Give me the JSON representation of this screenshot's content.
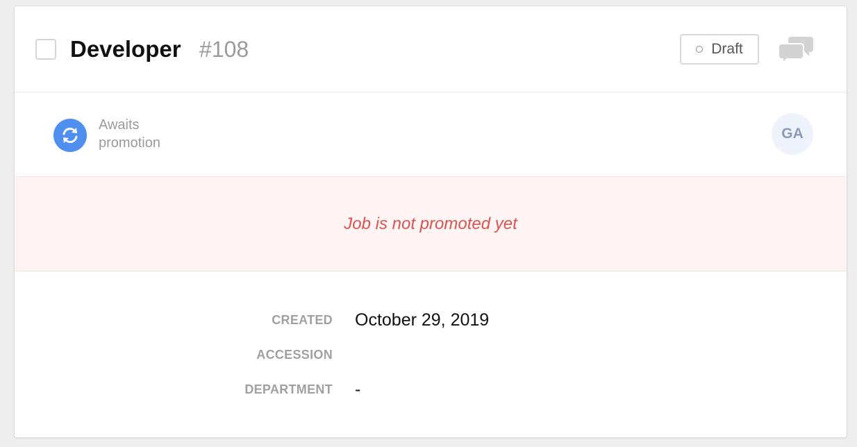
{
  "job": {
    "title": "Developer",
    "number": "#108",
    "status": "Draft"
  },
  "promotion": {
    "status_text": "Awaits promotion",
    "avatar_initials": "GA"
  },
  "alert": {
    "message": "Job is not promoted yet"
  },
  "details": [
    {
      "label": "CREATED",
      "value": "October 29, 2019"
    },
    {
      "label": "ACCESSION",
      "value": ""
    },
    {
      "label": "DEPARTMENT",
      "value": "-"
    }
  ],
  "icons": {
    "comments": "comments-icon",
    "promotion": "sync-icon"
  },
  "colors": {
    "accent_blue": "#4f8ff0",
    "alert_red": "#d9534f",
    "alert_background": "#fef4f3",
    "avatar_background": "#eef3fb"
  }
}
